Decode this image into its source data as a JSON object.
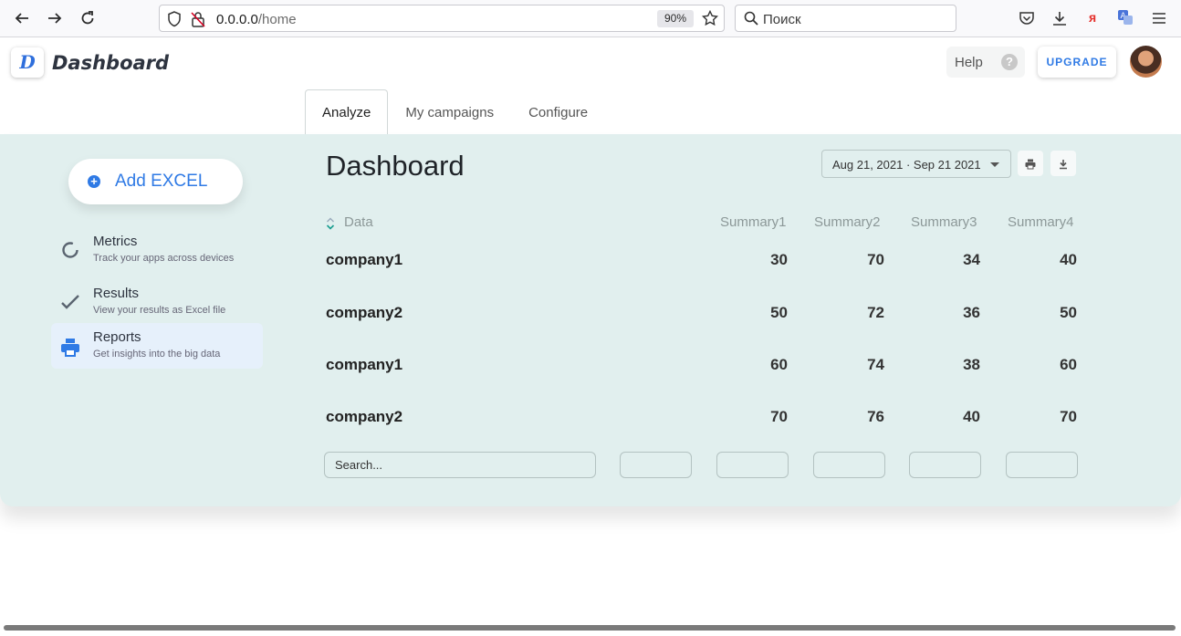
{
  "browser": {
    "url_host": "0.0.0.0",
    "url_path": "/home",
    "zoom": "90%",
    "search_placeholder": "Поиск",
    "ext_label": "я"
  },
  "header": {
    "logo_letter": "D",
    "brand": "Dashboard",
    "help_label": "Help",
    "help_icon": "?",
    "upgrade_label": "UPGRADE"
  },
  "tabs": [
    {
      "label": "Analyze",
      "active": true
    },
    {
      "label": "My campaigns",
      "active": false
    },
    {
      "label": "Configure",
      "active": false
    }
  ],
  "sidebar": {
    "add_label": "Add EXCEL",
    "items": [
      {
        "title": "Metrics",
        "subtitle": "Track your apps across devices",
        "icon": "circle-progress-icon"
      },
      {
        "title": "Results",
        "subtitle": "View your results as Excel file",
        "icon": "check-icon"
      },
      {
        "title": "Reports",
        "subtitle": "Get insights into the big data",
        "icon": "printer-icon"
      }
    ]
  },
  "main": {
    "title": "Dashboard",
    "date_range": "Aug 21, 2021 · Sep 21 2021",
    "columns": [
      "Data",
      "Summary1",
      "Summary2",
      "Summary3",
      "Summary4"
    ],
    "rows": [
      {
        "name": "company1",
        "values": [
          "30",
          "70",
          "34",
          "40"
        ]
      },
      {
        "name": "company2",
        "values": [
          "50",
          "72",
          "36",
          "50"
        ]
      },
      {
        "name": "company1",
        "values": [
          "60",
          "74",
          "38",
          "60"
        ]
      },
      {
        "name": "company2",
        "values": [
          "70",
          "76",
          "40",
          "70"
        ]
      }
    ],
    "search_placeholder": "Search..."
  },
  "colors": {
    "accent": "#2f7ae5",
    "panel_bg": "#e1efee"
  }
}
